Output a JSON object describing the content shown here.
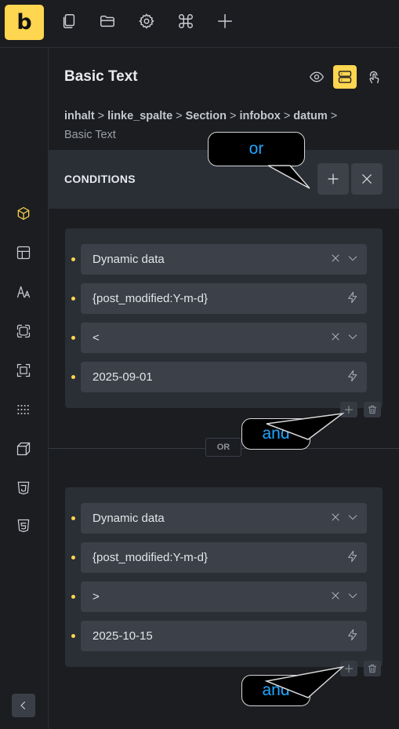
{
  "toolbar": {
    "logo_letter": "b",
    "icons": [
      "pages-icon",
      "folder-icon",
      "settings-icon",
      "command-icon",
      "plus-icon"
    ]
  },
  "sidebar": {
    "icons": [
      "cube-icon",
      "layout-icon",
      "typography-icon",
      "frame-icon",
      "focus-icon",
      "grid-dots-icon",
      "box-3d-icon",
      "css3-icon",
      "html5-icon"
    ],
    "active_index": 0,
    "collapse_icon": "chevron-left-icon"
  },
  "panel": {
    "title": "Basic Text",
    "header_icons": [
      "eye-icon",
      "conditions-icon",
      "interactions-icon"
    ],
    "breadcrumb": [
      "inhalt",
      "linke_spalte",
      "Section",
      "infobox",
      "datum"
    ],
    "breadcrumb_separator": ">",
    "breadcrumb_current": "Basic Text"
  },
  "conditions": {
    "heading": "CONDITIONS",
    "add_icon": "plus-icon",
    "close_icon": "close-icon",
    "or_label": "OR",
    "groups": [
      {
        "rows": [
          {
            "value": "Dynamic data",
            "controls": [
              "clear",
              "dropdown"
            ]
          },
          {
            "value": "{post_modified:Y-m-d}",
            "controls": [
              "dynamic"
            ]
          },
          {
            "value": "<",
            "controls": [
              "clear",
              "dropdown"
            ]
          },
          {
            "value": "2025-09-01",
            "controls": [
              "dynamic"
            ]
          }
        ]
      },
      {
        "rows": [
          {
            "value": "Dynamic data",
            "controls": [
              "clear",
              "dropdown"
            ]
          },
          {
            "value": "{post_modified:Y-m-d}",
            "controls": [
              "dynamic"
            ]
          },
          {
            "value": ">",
            "controls": [
              "clear",
              "dropdown"
            ]
          },
          {
            "value": "2025-10-15",
            "controls": [
              "dynamic"
            ]
          }
        ]
      }
    ]
  },
  "callouts": {
    "or_hint": "or",
    "and_hint_1": "and",
    "and_hint_2": "and"
  },
  "colors": {
    "accent": "#ffd64f",
    "background": "#1b1d21",
    "panel_row": "#3b4049",
    "callout_text": "#1ea6ff"
  }
}
